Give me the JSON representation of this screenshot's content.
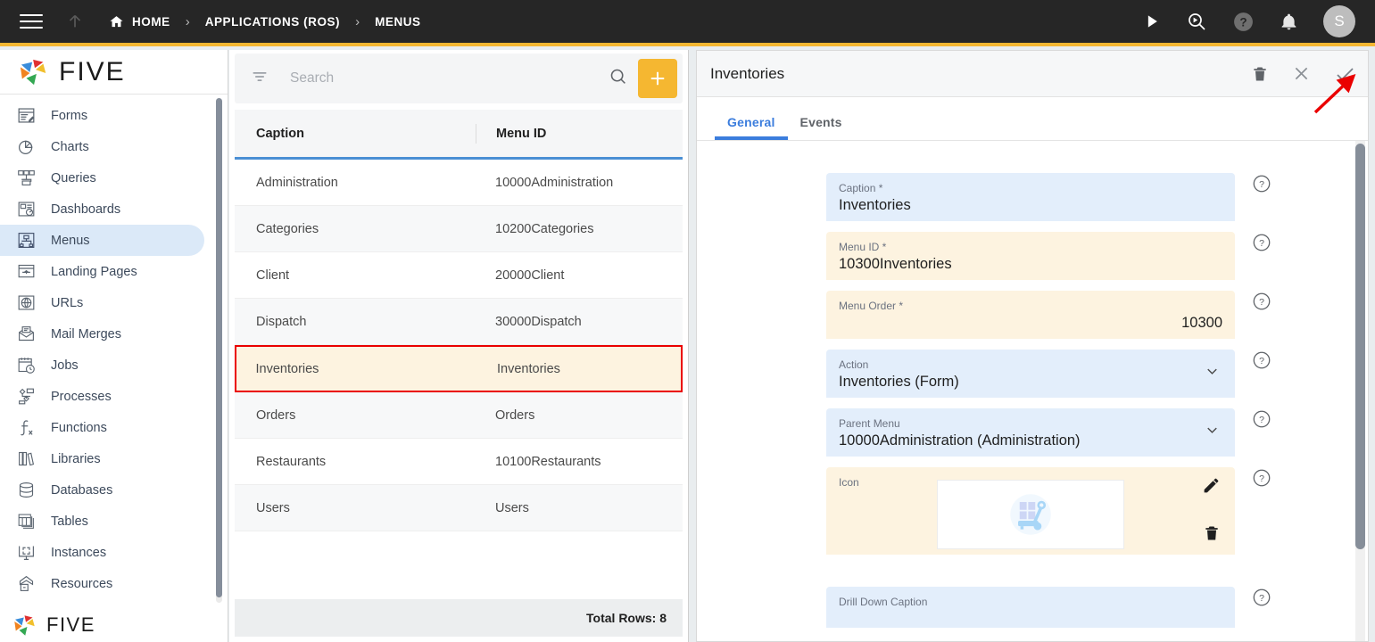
{
  "topbar": {
    "menu_icon": "hamburger-icon",
    "up_icon": "arrow-up-icon",
    "breadcrumbs": [
      {
        "label": "HOME",
        "icon": "home-icon"
      },
      {
        "label": "APPLICATIONS (ROS)",
        "icon": ""
      },
      {
        "label": "MENUS",
        "icon": ""
      }
    ],
    "separator": "›",
    "actions": [
      {
        "name": "run-icon",
        "title": "Run"
      },
      {
        "name": "debug-search-icon",
        "title": "Debug"
      },
      {
        "name": "help-icon",
        "title": "Help"
      },
      {
        "name": "notifications-bell-icon",
        "title": "Notifications"
      }
    ],
    "avatar_initial": "S",
    "accent_bar_color": "#f5b731",
    "background_color": "#262626"
  },
  "sidebar": {
    "brand": "FIVE",
    "brand_bottom": "FIVE",
    "items": [
      {
        "label": "Forms",
        "icon": "forms-icon",
        "active": false
      },
      {
        "label": "Charts",
        "icon": "charts-icon",
        "active": false
      },
      {
        "label": "Queries",
        "icon": "queries-icon",
        "active": false
      },
      {
        "label": "Dashboards",
        "icon": "dashboards-icon",
        "active": false
      },
      {
        "label": "Menus",
        "icon": "menus-icon",
        "active": true
      },
      {
        "label": "Landing Pages",
        "icon": "landing-pages-icon",
        "active": false
      },
      {
        "label": "URLs",
        "icon": "urls-icon",
        "active": false
      },
      {
        "label": "Mail Merges",
        "icon": "mail-merges-icon",
        "active": false
      },
      {
        "label": "Jobs",
        "icon": "jobs-icon",
        "active": false
      },
      {
        "label": "Processes",
        "icon": "processes-icon",
        "active": false
      },
      {
        "label": "Functions",
        "icon": "functions-icon",
        "active": false
      },
      {
        "label": "Libraries",
        "icon": "libraries-icon",
        "active": false
      },
      {
        "label": "Databases",
        "icon": "databases-icon",
        "active": false
      },
      {
        "label": "Tables",
        "icon": "tables-icon",
        "active": false
      },
      {
        "label": "Instances",
        "icon": "instances-icon",
        "active": false
      },
      {
        "label": "Resources",
        "icon": "resources-icon",
        "active": false
      }
    ],
    "active_bg_color": "#dbe9f8"
  },
  "list_panel": {
    "search": {
      "placeholder": "Search",
      "value": ""
    },
    "filter_icon": "filter-icon",
    "search_icon": "search-icon",
    "add_button": {
      "label": "+",
      "name": "add-record-button",
      "color": "#f5b731"
    },
    "columns": [
      "Caption",
      "Menu ID"
    ],
    "rows": [
      {
        "caption": "Administration",
        "menu_id": "10000Administration",
        "selected": false
      },
      {
        "caption": "Categories",
        "menu_id": "10200Categories",
        "selected": false
      },
      {
        "caption": "Client",
        "menu_id": "20000Client",
        "selected": false
      },
      {
        "caption": "Dispatch",
        "menu_id": "30000Dispatch",
        "selected": false
      },
      {
        "caption": "Inventories",
        "menu_id": "Inventories",
        "selected": true
      },
      {
        "caption": "Orders",
        "menu_id": "Orders",
        "selected": false
      },
      {
        "caption": "Restaurants",
        "menu_id": "10100Restaurants",
        "selected": false
      },
      {
        "caption": "Users",
        "menu_id": "Users",
        "selected": false
      }
    ],
    "footer_total": "Total Rows: 8",
    "header_underline_color": "#4a8fd4",
    "selected_row_border_color": "#ea0000",
    "selected_row_bg_color": "#fdf3e0"
  },
  "detail_panel": {
    "title": "Inventories",
    "actions": [
      {
        "name": "delete-icon",
        "title": "Delete"
      },
      {
        "name": "close-icon",
        "title": "Close"
      },
      {
        "name": "save-check-icon",
        "title": "Save"
      }
    ],
    "tabs": [
      {
        "label": "General",
        "active": true
      },
      {
        "label": "Events",
        "active": false
      }
    ],
    "active_tab_color": "#3b7ddd",
    "fields": [
      {
        "label": "Caption *",
        "value": "Inventories",
        "style": "blue",
        "type": "text",
        "name": "caption-field"
      },
      {
        "label": "Menu ID *",
        "value": "10300Inventories",
        "style": "amber",
        "type": "text",
        "name": "menu-id-field"
      },
      {
        "label": "Menu Order *",
        "value": "10300",
        "style": "amber",
        "type": "number",
        "name": "menu-order-field"
      },
      {
        "label": "Action",
        "value": "Inventories (Form)",
        "style": "blue",
        "type": "select",
        "name": "action-field"
      },
      {
        "label": "Parent Menu",
        "value": "10000Administration (Administration)",
        "style": "blue",
        "type": "select",
        "name": "parent-menu-field"
      },
      {
        "label": "Icon",
        "value": "",
        "style": "amber",
        "type": "image",
        "name": "icon-field",
        "image_icon": "hand-truck-boxes-icon"
      },
      {
        "label": "",
        "value": "",
        "placeholder": "Drill Down Caption",
        "style": "blue",
        "type": "text",
        "name": "drill-down-caption-field"
      }
    ],
    "icon_tools": [
      {
        "name": "edit-pencil-icon",
        "title": "Edit"
      },
      {
        "name": "delete-trash-icon",
        "title": "Delete"
      }
    ],
    "help_icon": "help-circle-icon"
  },
  "annotation": {
    "arrow_color": "#ea0000",
    "name": "red-arrow-pointing-to-save"
  }
}
